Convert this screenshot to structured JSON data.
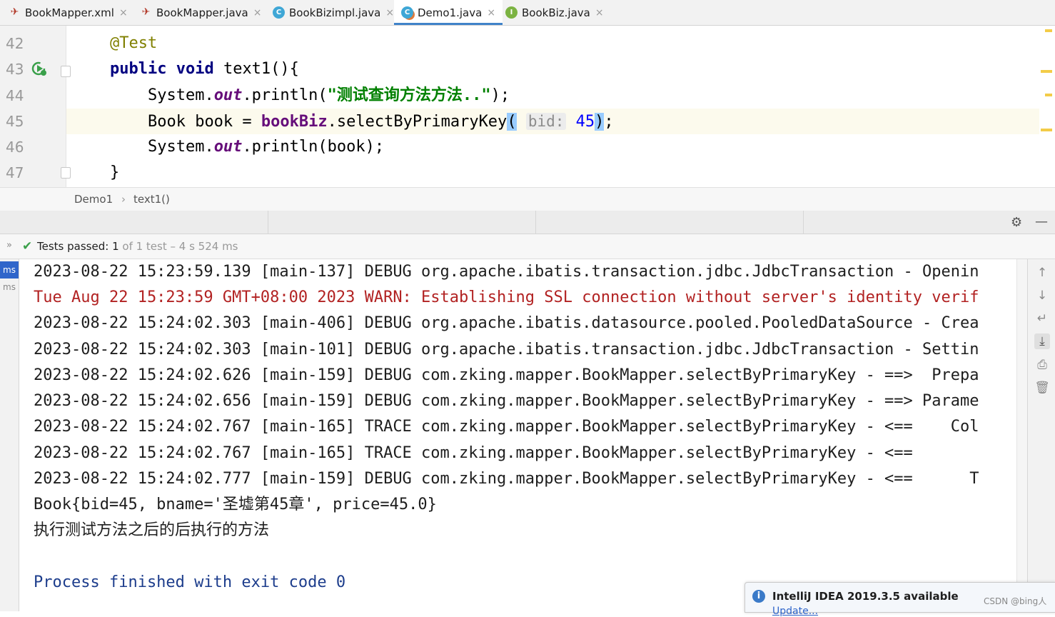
{
  "tabs": [
    {
      "label": "BookMapper.xml",
      "icon": "mybatis-bird-icon"
    },
    {
      "label": "BookMapper.java",
      "icon": "mybatis-bird-icon"
    },
    {
      "label": "BookBizimpl.java",
      "icon": "class-icon",
      "icon_glyph": "C"
    },
    {
      "label": "Demo1.java",
      "icon": "test-class-icon",
      "icon_glyph": "C",
      "active": true
    },
    {
      "label": "BookBiz.java",
      "icon": "interface-icon",
      "icon_glyph": "I"
    }
  ],
  "tab_close_glyph": "×",
  "editor": {
    "line_numbers": [
      "42",
      "43",
      "44",
      "45",
      "46",
      "47"
    ],
    "current_line": "45",
    "code": {
      "l42_annotation": "@Test",
      "l43_kw1": "public",
      "l43_kw2": "void",
      "l43_rest": " text1(){",
      "l44_a": "System.",
      "l44_out": "out",
      "l44_b": ".println(",
      "l44_str": "\"测试查询方法方法..\"",
      "l44_c": ");",
      "l45_a": "Book book = ",
      "l45_field": "bookBiz",
      "l45_b": ".selectByPrimaryKey",
      "l45_open": "(",
      "l45_hint": "bid:",
      "l45_num": "45",
      "l45_close": ")",
      "l45_end": ";",
      "l46_a": "System.",
      "l46_out": "out",
      "l46_b": ".println(book);",
      "l47": "}"
    }
  },
  "breadcrumb": {
    "class": "Demo1",
    "sep": "›",
    "method": "text1()"
  },
  "test_status": {
    "label": "Tests passed:",
    "count": "1",
    "detail": "of 1 test – 4 s 524 ms"
  },
  "rail": [
    "ms",
    "ms"
  ],
  "console": [
    {
      "text": "2023-08-22 15:23:59.139 [main-137] DEBUG org.apache.ibatis.transaction.jdbc.JdbcTransaction - Openin",
      "type": "log"
    },
    {
      "text": "Tue Aug 22 15:23:59 GMT+08:00 2023 WARN: Establishing SSL connection without server's identity verif",
      "type": "err"
    },
    {
      "text": "2023-08-22 15:24:02.303 [main-406] DEBUG org.apache.ibatis.datasource.pooled.PooledDataSource - Crea",
      "type": "log"
    },
    {
      "text": "2023-08-22 15:24:02.303 [main-101] DEBUG org.apache.ibatis.transaction.jdbc.JdbcTransaction - Settin",
      "type": "log"
    },
    {
      "text": "2023-08-22 15:24:02.626 [main-159] DEBUG com.zking.mapper.BookMapper.selectByPrimaryKey - ==>  Prepa",
      "type": "log"
    },
    {
      "text": "2023-08-22 15:24:02.656 [main-159] DEBUG com.zking.mapper.BookMapper.selectByPrimaryKey - ==> Parame",
      "type": "log"
    },
    {
      "text": "2023-08-22 15:24:02.767 [main-165] TRACE com.zking.mapper.BookMapper.selectByPrimaryKey - <==    Col",
      "type": "log"
    },
    {
      "text": "2023-08-22 15:24:02.767 [main-165] TRACE com.zking.mapper.BookMapper.selectByPrimaryKey - <==",
      "type": "log"
    },
    {
      "text": "2023-08-22 15:24:02.777 [main-159] DEBUG com.zking.mapper.BookMapper.selectByPrimaryKey - <==      T",
      "type": "log"
    },
    {
      "text": "Book{bid=45, bname='圣墟第45章', price=45.0}",
      "type": "log"
    },
    {
      "text": "执行测试方法之后的后执行的方法",
      "type": "log"
    },
    {
      "text": "",
      "type": "log"
    },
    {
      "text": "Process finished with exit code 0",
      "type": "proc"
    }
  ],
  "notification": {
    "title": "IntelliJ IDEA 2019.3.5 available",
    "link": "Update...",
    "icon_glyph": "i"
  },
  "watermark": "CSDN @bing人",
  "colors": {
    "accent": "#4083c9",
    "pass_green": "#3aa04a",
    "warn_red": "#b22222",
    "keyword": "#000080",
    "string": "#008000"
  }
}
